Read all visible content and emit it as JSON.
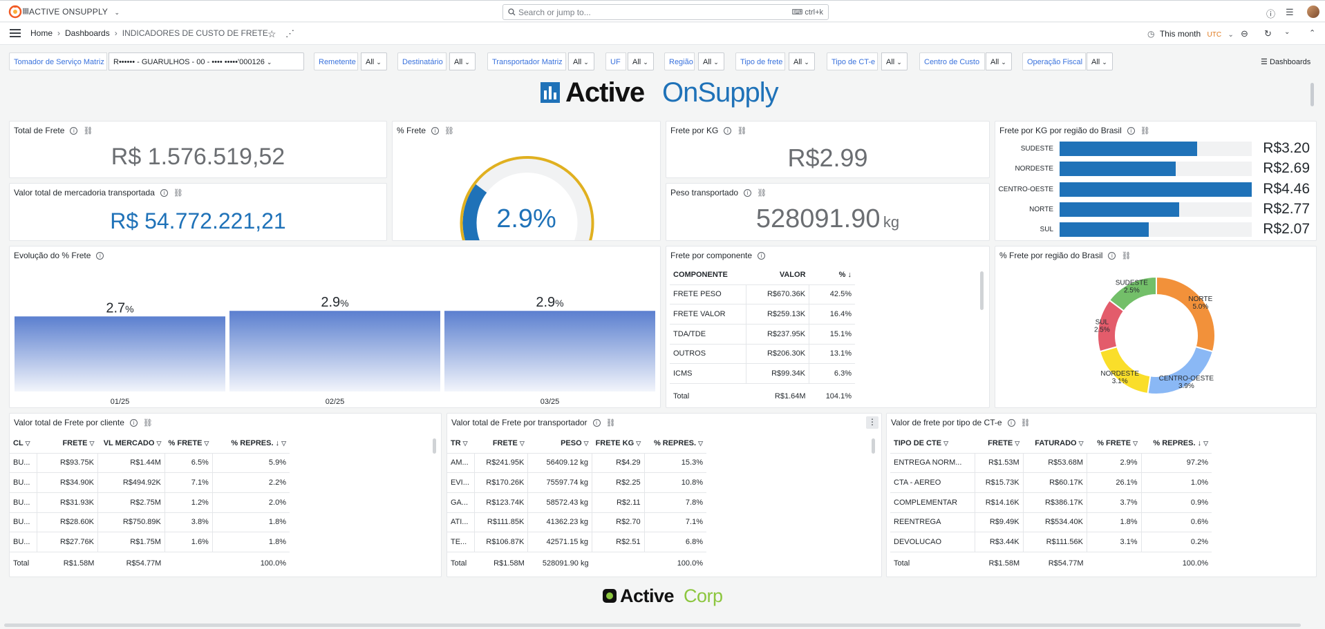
{
  "topbar": {
    "org_name": "ACTIVE ONSUPPLY",
    "search_placeholder": "Search or jump to...",
    "search_shortcut": "ctrl+k"
  },
  "navbar": {
    "breadcrumbs": [
      "Home",
      "Dashboards",
      "INDICADORES DE CUSTO DE FRETE"
    ],
    "time_range": "This month",
    "timezone": "UTC"
  },
  "variables": [
    {
      "label": "Tomador de Serviço Matriz",
      "value": "R•••••• - GUARULHOS - 00 - •••• •••••'000126"
    },
    {
      "label": "Remetente",
      "value": "All"
    },
    {
      "label": "Destinatário",
      "value": "All"
    },
    {
      "label": "Transportador Matriz",
      "value": "All"
    },
    {
      "label": "UF",
      "value": "All"
    },
    {
      "label": "Região",
      "value": "All"
    },
    {
      "label": "Tipo de frete",
      "value": "All"
    },
    {
      "label": "Tipo de CT-e",
      "value": "All"
    },
    {
      "label": "Centro de Custo",
      "value": "All"
    },
    {
      "label": "Operação Fiscal",
      "value": "All"
    }
  ],
  "dashboards_link": "Dashboards",
  "brand": {
    "word1": "Active",
    "word2": "OnSupply",
    "footer1": "Active",
    "footer2": "Corp",
    "blue": "#1f72b8",
    "green": "#8cc63f"
  },
  "panels": {
    "total_frete": {
      "title": "Total de Frete",
      "value": "R$ 1.576.519,52"
    },
    "valor_mercadoria": {
      "title": "Valor total de mercadoria transportada",
      "value": "R$ 54.772.221,21"
    },
    "pct_frete": {
      "title": "% Frete",
      "value": "2.9%",
      "gauge_fraction": 0.29
    },
    "frete_kg": {
      "title": "Frete por KG",
      "value": "R$2.99"
    },
    "peso": {
      "title": "Peso transportado",
      "value": "528091.90",
      "unit": "kg"
    },
    "frete_kg_regiao": {
      "title": "Frete por KG por região do Brasil",
      "rows": [
        {
          "label": "SUDESTE",
          "value": "R$3.20",
          "num": 3.2
        },
        {
          "label": "NORDESTE",
          "value": "R$2.69",
          "num": 2.69
        },
        {
          "label": "CENTRO-OESTE",
          "value": "R$4.46",
          "num": 4.46
        },
        {
          "label": "NORTE",
          "value": "R$2.77",
          "num": 2.77
        },
        {
          "label": "SUL",
          "value": "R$2.07",
          "num": 2.07
        }
      ]
    },
    "evolucao": {
      "title": "Evolução do % Frete"
    },
    "componente": {
      "title": "Frete por componente",
      "headers": [
        "COMPONENTE",
        "VALOR",
        "%"
      ],
      "rows": [
        [
          "FRETE PESO",
          "R$670.36K",
          "42.5%"
        ],
        [
          "FRETE VALOR",
          "R$259.13K",
          "16.4%"
        ],
        [
          "TDA/TDE",
          "R$237.95K",
          "15.1%"
        ],
        [
          "OUTROS",
          "R$206.30K",
          "13.1%"
        ],
        [
          "ICMS",
          "R$99.34K",
          "6.3%"
        ]
      ],
      "total": [
        "Total",
        "R$1.64M",
        "104.1%"
      ]
    },
    "pct_regiao": {
      "title": "% Frete por região do Brasil"
    },
    "por_cliente": {
      "title": "Valor total de Frete por cliente",
      "headers": [
        "CL",
        "FRETE",
        "VL MERCADO",
        "% FRETE",
        "% REPRES."
      ],
      "rows": [
        [
          "BU...",
          "R$93.75K",
          "R$1.44M",
          "6.5%",
          "5.9%"
        ],
        [
          "BU...",
          "R$34.90K",
          "R$494.92K",
          "7.1%",
          "2.2%"
        ],
        [
          "BU...",
          "R$31.93K",
          "R$2.75M",
          "1.2%",
          "2.0%"
        ],
        [
          "BU...",
          "R$28.60K",
          "R$750.89K",
          "3.8%",
          "1.8%"
        ],
        [
          "BU...",
          "R$27.76K",
          "R$1.75M",
          "1.6%",
          "1.8%"
        ]
      ],
      "total": [
        "Total",
        "R$1.58M",
        "R$54.77M",
        "",
        "100.0%"
      ]
    },
    "por_transportador": {
      "title": "Valor total de Frete por transportador",
      "headers": [
        "TR",
        "FRETE",
        "PESO",
        "FRETE KG",
        "% REPRES."
      ],
      "rows": [
        [
          "AM...",
          "R$241.95K",
          "56409.12 kg",
          "R$4.29",
          "15.3%"
        ],
        [
          "EVI...",
          "R$170.26K",
          "75597.74 kg",
          "R$2.25",
          "10.8%"
        ],
        [
          "GA...",
          "R$123.74K",
          "58572.43 kg",
          "R$2.11",
          "7.8%"
        ],
        [
          "ATI...",
          "R$111.85K",
          "41362.23 kg",
          "R$2.70",
          "7.1%"
        ],
        [
          "TE...",
          "R$106.87K",
          "42571.15 kg",
          "R$2.51",
          "6.8%"
        ]
      ],
      "total": [
        "Total",
        "R$1.58M",
        "528091.90 kg",
        "",
        "100.0%"
      ]
    },
    "por_tipo_cte": {
      "title": "Valor de frete por tipo de CT-e",
      "headers": [
        "TIPO DE CTE",
        "FRETE",
        "FATURADO",
        "% FRETE",
        "% REPRES."
      ],
      "rows": [
        [
          "ENTREGA NORM...",
          "R$1.53M",
          "R$53.68M",
          "2.9%",
          "97.2%"
        ],
        [
          "CTA - AEREO",
          "R$15.73K",
          "R$60.17K",
          "26.1%",
          "1.0%"
        ],
        [
          "COMPLEMENTAR",
          "R$14.16K",
          "R$386.17K",
          "3.7%",
          "0.9%"
        ],
        [
          "REENTREGA",
          "R$9.49K",
          "R$534.40K",
          "1.8%",
          "0.6%"
        ],
        [
          "DEVOLUCAO",
          "R$3.44K",
          "R$111.56K",
          "3.1%",
          "0.2%"
        ]
      ],
      "total": [
        "Total",
        "R$1.58M",
        "R$54.77M",
        "",
        "100.0%"
      ]
    }
  },
  "chart_data": [
    {
      "type": "bar",
      "title": "Evolução do % Frete",
      "categories": [
        "01/25",
        "02/25",
        "03/25"
      ],
      "values": [
        2.7,
        2.9,
        2.9
      ],
      "labels": [
        "2.7",
        "2.9",
        "2.9"
      ],
      "unit": "%",
      "color": "#5b7fcf"
    },
    {
      "type": "pie",
      "title": "% Frete por região do Brasil",
      "slices": [
        {
          "name": "NORTE",
          "label": "5.0%",
          "value": 5.0,
          "color": "#f2913a"
        },
        {
          "name": "CENTRO-OESTE",
          "label": "3.9%",
          "value": 3.9,
          "color": "#8ab8f5"
        },
        {
          "name": "NORDESTE",
          "label": "3.1%",
          "value": 3.1,
          "color": "#fade2a"
        },
        {
          "name": "SUL",
          "label": "2.5%",
          "value": 2.5,
          "color": "#e35c6b"
        },
        {
          "name": "SUDESTE",
          "label": "2.5%",
          "value": 2.5,
          "color": "#73bf69"
        }
      ]
    }
  ]
}
